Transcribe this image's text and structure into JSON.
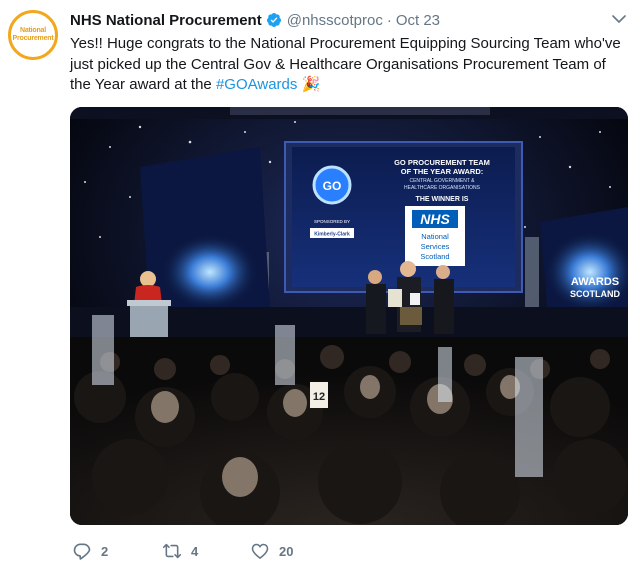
{
  "tweet": {
    "author_name": "NHS National Procurement",
    "handle": "@nhsscotproc",
    "separator": "·",
    "date": "Oct 23",
    "avatar_line1": "National",
    "avatar_line2": "Procurement",
    "text_main": "Yes!! Huge congrats to the National Procurement Equipping Sourcing Team who've just picked up the Central Gov & Healthcare Organisations Procurement Team of the Year award at the ",
    "hashtag": "#GOAwards",
    "emoji": "🎉",
    "replies": "2",
    "retweets": "4",
    "likes": "20"
  },
  "photo": {
    "screen_title_1": "GO PROCUREMENT TEAM",
    "screen_title_2": "OF THE YEAR AWARD:",
    "screen_sub_1": "CENTRAL GOVERNMENT &",
    "screen_sub_2": "HEALTHCARE ORGANISATIONS",
    "winner_label": "THE WINNER IS",
    "nhs_logo": "NHS",
    "nhs_line1": "National",
    "nhs_line2": "Services",
    "nhs_line3": "Scotland",
    "sponsored_by": "SPONSORED BY",
    "sponsor_name": "Kimberly-Clark",
    "go_logo": "GO",
    "side_logo_line1": "AWARDS",
    "side_logo_line2": "SCOTLAND",
    "table_number": "12"
  },
  "colors": {
    "link": "#1b95e0",
    "muted": "#657786",
    "avatar_ring": "#f2a81d",
    "verified": "#1da1f2"
  }
}
